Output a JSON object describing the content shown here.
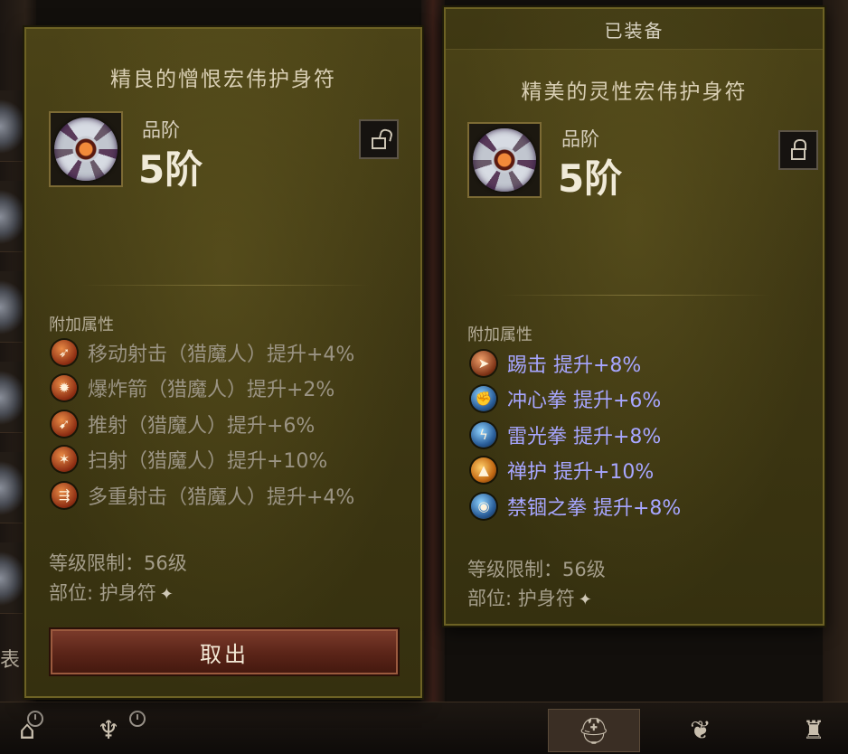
{
  "background": {
    "side_label": "表"
  },
  "left_panel": {
    "item_name": "精良的憎恨宏伟护身符",
    "rank_label": "品阶",
    "rank_value": "5阶",
    "lock_state": "unlocked",
    "section_title": "附加属性",
    "affixes": [
      {
        "text": "移动射击（猎魔人）提升+4%",
        "icon": "arrow-shot-icon"
      },
      {
        "text": "爆炸箭（猎魔人）提升+2%",
        "icon": "explosive-arrow-icon"
      },
      {
        "text": "推射（猎魔人）提升+6%",
        "icon": "impale-icon"
      },
      {
        "text": "扫射（猎魔人）提升+10%",
        "icon": "strafe-icon"
      },
      {
        "text": "多重射击（猎魔人）提升+4%",
        "icon": "multishot-icon"
      }
    ],
    "level_req": "等级限制：56级",
    "slot": "部位: 护身符",
    "action_button": "取出"
  },
  "right_panel": {
    "header": "已装备",
    "item_name": "精美的灵性宏伟护身符",
    "rank_label": "品阶",
    "rank_value": "5阶",
    "lock_state": "locked",
    "section_title": "附加属性",
    "affixes": [
      {
        "text": "踢击  提升+8%",
        "icon": "kick-icon"
      },
      {
        "text": "冲心拳  提升+6%",
        "icon": "heart-strike-icon"
      },
      {
        "text": "雷光拳  提升+8%",
        "icon": "thunder-fist-icon"
      },
      {
        "text": "禅护  提升+10%",
        "icon": "zen-guard-icon"
      },
      {
        "text": "禁锢之拳  提升+8%",
        "icon": "binding-fist-icon"
      }
    ],
    "level_req": "等级限制：56级",
    "slot": "部位: 护身符"
  },
  "colors": {
    "panel_bg": "#3e3713",
    "affix_inactive": "#9b9484",
    "affix_active": "#a7a6ff",
    "button_red": "#5a2418"
  }
}
